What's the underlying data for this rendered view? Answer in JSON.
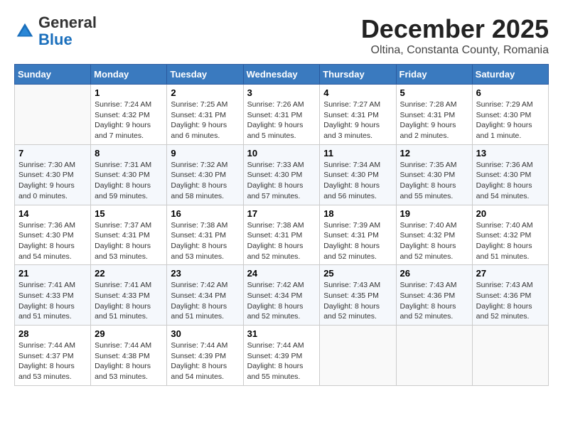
{
  "logo": {
    "general": "General",
    "blue": "Blue"
  },
  "title": "December 2025",
  "subtitle": "Oltina, Constanta County, Romania",
  "days_header": [
    "Sunday",
    "Monday",
    "Tuesday",
    "Wednesday",
    "Thursday",
    "Friday",
    "Saturday"
  ],
  "weeks": [
    [
      {
        "day": "",
        "info": ""
      },
      {
        "day": "1",
        "info": "Sunrise: 7:24 AM\nSunset: 4:32 PM\nDaylight: 9 hours\nand 7 minutes."
      },
      {
        "day": "2",
        "info": "Sunrise: 7:25 AM\nSunset: 4:31 PM\nDaylight: 9 hours\nand 6 minutes."
      },
      {
        "day": "3",
        "info": "Sunrise: 7:26 AM\nSunset: 4:31 PM\nDaylight: 9 hours\nand 5 minutes."
      },
      {
        "day": "4",
        "info": "Sunrise: 7:27 AM\nSunset: 4:31 PM\nDaylight: 9 hours\nand 3 minutes."
      },
      {
        "day": "5",
        "info": "Sunrise: 7:28 AM\nSunset: 4:31 PM\nDaylight: 9 hours\nand 2 minutes."
      },
      {
        "day": "6",
        "info": "Sunrise: 7:29 AM\nSunset: 4:30 PM\nDaylight: 9 hours\nand 1 minute."
      }
    ],
    [
      {
        "day": "7",
        "info": "Sunrise: 7:30 AM\nSunset: 4:30 PM\nDaylight: 9 hours\nand 0 minutes."
      },
      {
        "day": "8",
        "info": "Sunrise: 7:31 AM\nSunset: 4:30 PM\nDaylight: 8 hours\nand 59 minutes."
      },
      {
        "day": "9",
        "info": "Sunrise: 7:32 AM\nSunset: 4:30 PM\nDaylight: 8 hours\nand 58 minutes."
      },
      {
        "day": "10",
        "info": "Sunrise: 7:33 AM\nSunset: 4:30 PM\nDaylight: 8 hours\nand 57 minutes."
      },
      {
        "day": "11",
        "info": "Sunrise: 7:34 AM\nSunset: 4:30 PM\nDaylight: 8 hours\nand 56 minutes."
      },
      {
        "day": "12",
        "info": "Sunrise: 7:35 AM\nSunset: 4:30 PM\nDaylight: 8 hours\nand 55 minutes."
      },
      {
        "day": "13",
        "info": "Sunrise: 7:36 AM\nSunset: 4:30 PM\nDaylight: 8 hours\nand 54 minutes."
      }
    ],
    [
      {
        "day": "14",
        "info": "Sunrise: 7:36 AM\nSunset: 4:30 PM\nDaylight: 8 hours\nand 54 minutes."
      },
      {
        "day": "15",
        "info": "Sunrise: 7:37 AM\nSunset: 4:31 PM\nDaylight: 8 hours\nand 53 minutes."
      },
      {
        "day": "16",
        "info": "Sunrise: 7:38 AM\nSunset: 4:31 PM\nDaylight: 8 hours\nand 53 minutes."
      },
      {
        "day": "17",
        "info": "Sunrise: 7:38 AM\nSunset: 4:31 PM\nDaylight: 8 hours\nand 52 minutes."
      },
      {
        "day": "18",
        "info": "Sunrise: 7:39 AM\nSunset: 4:31 PM\nDaylight: 8 hours\nand 52 minutes."
      },
      {
        "day": "19",
        "info": "Sunrise: 7:40 AM\nSunset: 4:32 PM\nDaylight: 8 hours\nand 52 minutes."
      },
      {
        "day": "20",
        "info": "Sunrise: 7:40 AM\nSunset: 4:32 PM\nDaylight: 8 hours\nand 51 minutes."
      }
    ],
    [
      {
        "day": "21",
        "info": "Sunrise: 7:41 AM\nSunset: 4:33 PM\nDaylight: 8 hours\nand 51 minutes."
      },
      {
        "day": "22",
        "info": "Sunrise: 7:41 AM\nSunset: 4:33 PM\nDaylight: 8 hours\nand 51 minutes."
      },
      {
        "day": "23",
        "info": "Sunrise: 7:42 AM\nSunset: 4:34 PM\nDaylight: 8 hours\nand 51 minutes."
      },
      {
        "day": "24",
        "info": "Sunrise: 7:42 AM\nSunset: 4:34 PM\nDaylight: 8 hours\nand 52 minutes."
      },
      {
        "day": "25",
        "info": "Sunrise: 7:43 AM\nSunset: 4:35 PM\nDaylight: 8 hours\nand 52 minutes."
      },
      {
        "day": "26",
        "info": "Sunrise: 7:43 AM\nSunset: 4:36 PM\nDaylight: 8 hours\nand 52 minutes."
      },
      {
        "day": "27",
        "info": "Sunrise: 7:43 AM\nSunset: 4:36 PM\nDaylight: 8 hours\nand 52 minutes."
      }
    ],
    [
      {
        "day": "28",
        "info": "Sunrise: 7:44 AM\nSunset: 4:37 PM\nDaylight: 8 hours\nand 53 minutes."
      },
      {
        "day": "29",
        "info": "Sunrise: 7:44 AM\nSunset: 4:38 PM\nDaylight: 8 hours\nand 53 minutes."
      },
      {
        "day": "30",
        "info": "Sunrise: 7:44 AM\nSunset: 4:39 PM\nDaylight: 8 hours\nand 54 minutes."
      },
      {
        "day": "31",
        "info": "Sunrise: 7:44 AM\nSunset: 4:39 PM\nDaylight: 8 hours\nand 55 minutes."
      },
      {
        "day": "",
        "info": ""
      },
      {
        "day": "",
        "info": ""
      },
      {
        "day": "",
        "info": ""
      }
    ]
  ]
}
